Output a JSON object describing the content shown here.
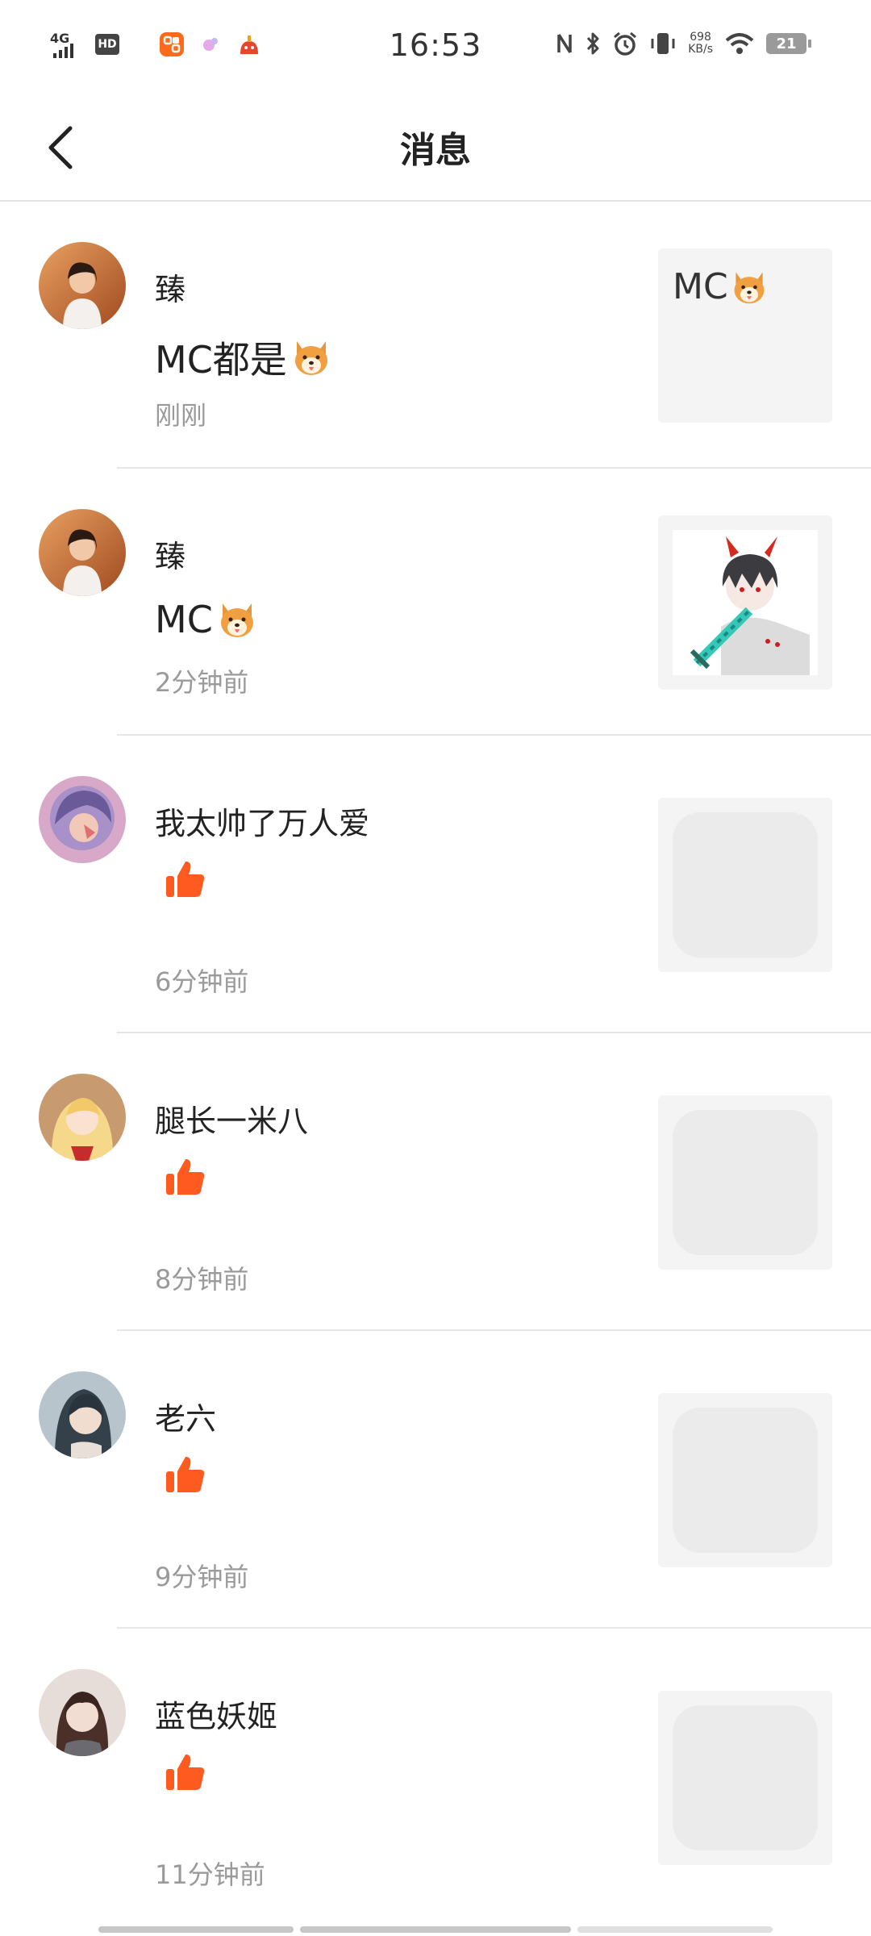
{
  "status_bar": {
    "network": "4G",
    "hd": "HD",
    "time": "16:53",
    "speed_value": "698",
    "speed_unit": "KB/s",
    "battery": "21",
    "icons": [
      "nfc-icon",
      "bluetooth-icon",
      "alarm-icon",
      "vibrate-icon",
      "wifi-icon"
    ]
  },
  "header": {
    "title": "消息",
    "back_icon": "chevron-left-icon"
  },
  "accent_color": "#ff5a1f",
  "notifications": [
    {
      "name": "臻",
      "comment": "MC都是",
      "comment_emoji": "shiba-dog-emoji",
      "time": "刚刚",
      "thumb_text": "MC"
    },
    {
      "name": "臻",
      "comment": "MC",
      "comment_emoji": "shiba-dog-emoji",
      "time": "2分钟前",
      "thumb_image": "anime-boy-with-diamond-sword"
    },
    {
      "name": "我太帅了万人爱",
      "type": "like",
      "time": "6分钟前"
    },
    {
      "name": "腿长一米八",
      "type": "like",
      "time": "8分钟前"
    },
    {
      "name": "老六",
      "type": "like",
      "time": "9分钟前"
    },
    {
      "name": "蓝色妖姬",
      "type": "like",
      "time": "11分钟前"
    }
  ]
}
